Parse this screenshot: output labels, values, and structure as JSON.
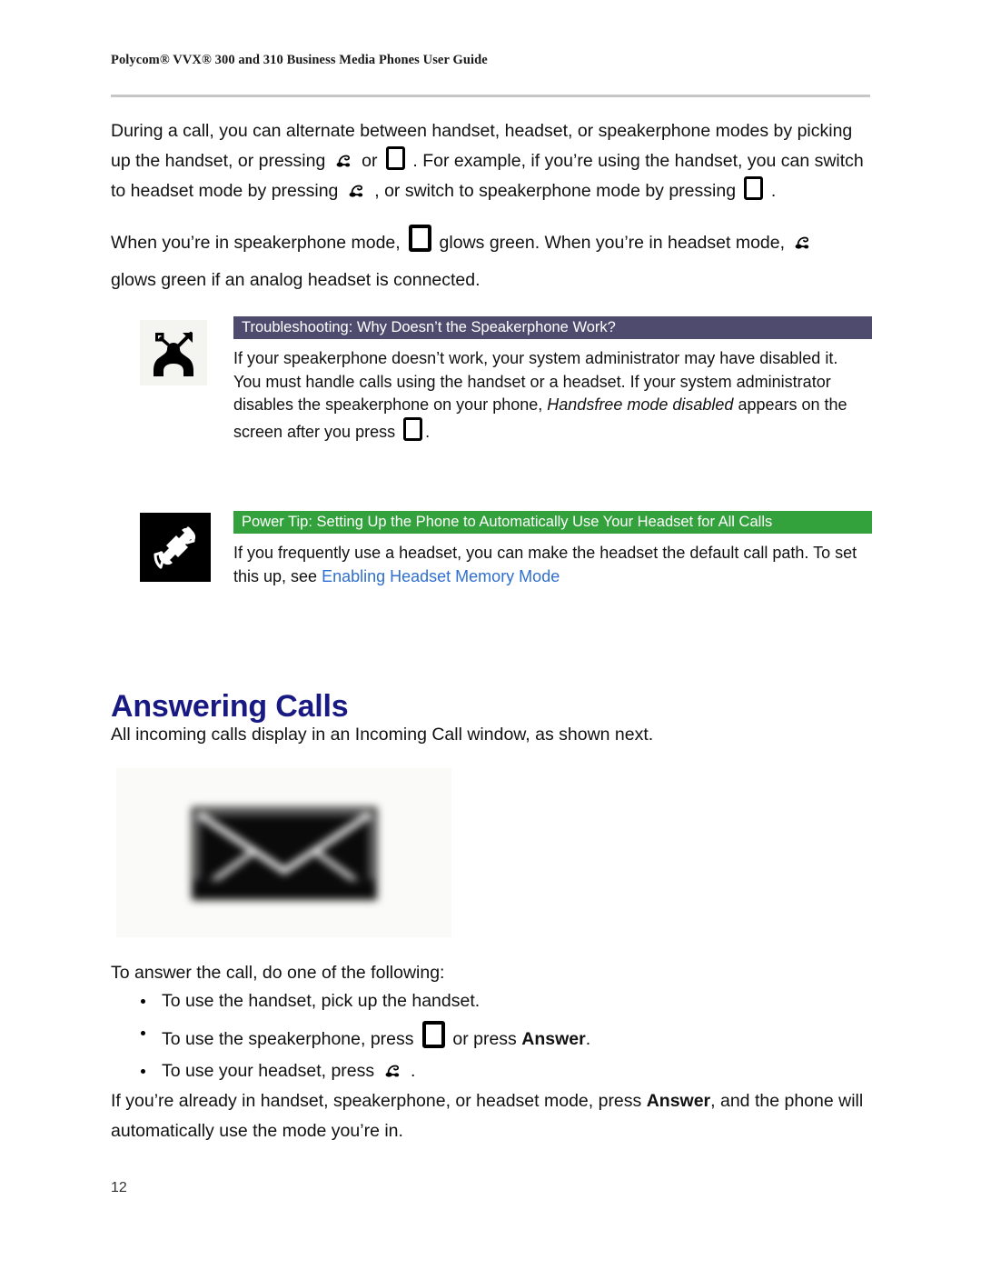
{
  "header": {
    "running_head": "Polycom® VVX® 300 and 310 Business Media Phones User Guide"
  },
  "paragraphs": {
    "p1_part1": "During a call, you can alternate between handset, headset, or speakerphone modes by picking up the handset, or pressing",
    "p1_part2": "or",
    "p1_part3": ". For example, if you’re using the handset, you can switch to headset mode by pressing",
    "p1_part4": ", or switch to speakerphone mode by pressing",
    "p1_part5": ".",
    "p2_part1": "When you’re in speakerphone mode,",
    "p2_part2": "glows green. When you’re in headset mode,",
    "p2_part3": "glows green if an analog headset is connected.",
    "intro_figure": "All incoming calls display in an Incoming Call window, as shown next.",
    "final_part1": "If you’re already in handset, speakerphone, or headset mode, press",
    "final_bold": "Answer",
    "final_part2": ", and the phone will automatically use the mode you’re in."
  },
  "callouts": [
    {
      "id": "troubleshooting",
      "icon_name": "phone-offhook-arrow-icon",
      "bar_color": "#4e4b6e",
      "title": "Troubleshooting: Why Doesn’t the Speakerphone Work?",
      "text_part1": "If your speakerphone doesn’t work, your system administrator may have disabled it. You must handle calls using the handset or a headset. If your system administrator disables the speakerphone on your phone,",
      "text_italic": "Handsfree mode disabled",
      "text_part2": "appears on the screen after you press",
      "text_part3": "."
    },
    {
      "id": "power-tip",
      "icon_name": "handset-diagonal-icon",
      "bar_color": "#33a23d",
      "title": "Power Tip: Setting Up the Phone to Automatically Use Your Headset for All Calls",
      "text_part1": "If you frequently use a headset, you can make the headset the default call path. To set this up, see",
      "link_text": "Enabling Headset Memory Mode"
    }
  ],
  "section": {
    "heading": "Answering Calls",
    "heading_color": "#191983"
  },
  "figure": {
    "caption": "",
    "icon_name": "envelope-message-icon"
  },
  "list": {
    "lead": "To answer the call, do one of the following:",
    "items": [
      {
        "before": "To use the handset, pick up the handset.",
        "icon": "",
        "middle": "",
        "bold": "",
        "after": ""
      },
      {
        "before": "To use the speakerphone, press",
        "icon": "speakerphone-icon",
        "middle": "or press",
        "bold": "Answer",
        "after": "."
      },
      {
        "before": "To use your headset, press",
        "icon": "headset-icon",
        "middle": "",
        "bold": "",
        "after": "."
      }
    ]
  },
  "footer": {
    "page_number": "12"
  },
  "colors": {
    "link": "#2f6fd0",
    "heading": "#191983",
    "troubleshooting_bar": "#4e4b6e",
    "powertip_bar": "#33a23d",
    "rule": "#c6c6c6"
  }
}
